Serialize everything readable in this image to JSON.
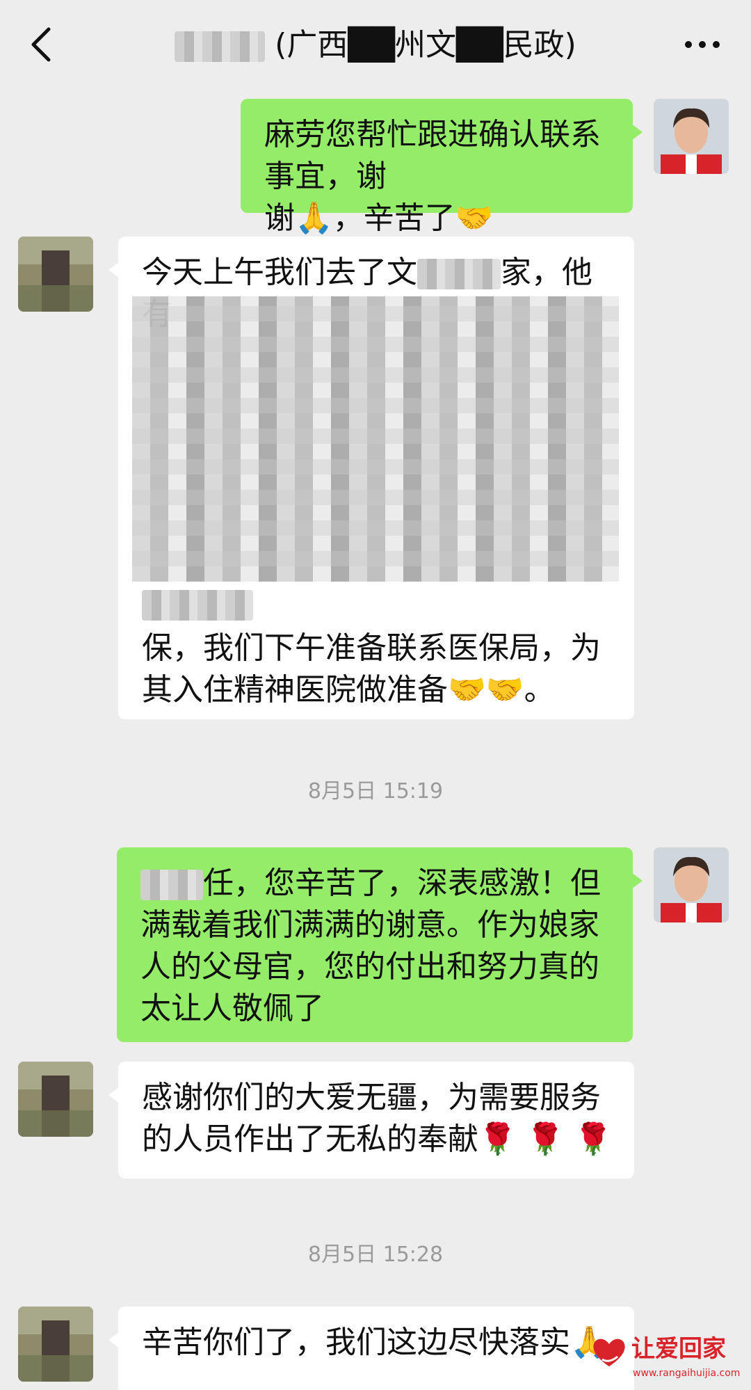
{
  "header": {
    "title_visible_suffix": "(广西██州文██民政)",
    "back_icon": "chevron-left-icon",
    "more_icon": "more-dots-icon"
  },
  "messages": [
    {
      "side": "sent",
      "text_a": "麻劳您帮忙跟进确认联系事宜，谢",
      "text_b": "谢",
      "emoji1": "🙏",
      "text_c": "，辛苦了",
      "emoji2": "🤝"
    },
    {
      "side": "recv",
      "line1_a": "今天上午我们去了文",
      "line1_b": "家，他有",
      "line_last1": "保，我们下午准备联系医保局，为",
      "line_last2": "其入住精神医院做准备",
      "emoji": "🤝🤝",
      "end": "。"
    },
    {
      "side": "sent",
      "line1_b": "任，您辛苦了，深表感激！但",
      "line2": "满载着我们满满的谢意。作为娘家",
      "line3": "人的父母官，您的付出和努力真的",
      "line4": "太让人敬佩了"
    },
    {
      "side": "recv",
      "line1": "感谢你们的大爱无疆，为需要服务",
      "line2": "的人员作出了无私的奉献",
      "emoji": "🌹 🌹 🌹"
    },
    {
      "side": "recv",
      "line1": "辛苦你们了，我们这边尽快落实",
      "emoji": "🙏"
    }
  ],
  "timestamps": [
    "8月5日 15:19",
    "8月5日 15:28"
  ],
  "watermark": {
    "text": "让爱回家",
    "url": "www.rangaihuijia.com",
    "color": "#d8232a"
  },
  "colors": {
    "sent_bubble": "#95ec69",
    "recv_bubble": "#ffffff",
    "background": "#ededed"
  }
}
